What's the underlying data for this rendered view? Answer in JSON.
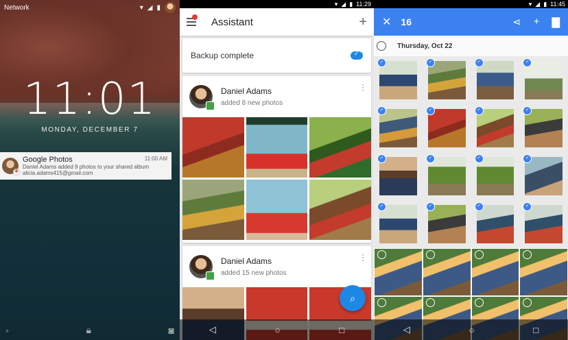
{
  "lock": {
    "network": "Network",
    "time": "11:01",
    "date": "MONDAY, DECEMBER 7",
    "notification": {
      "title": "Google Photos",
      "time": "11:00 AM",
      "line1": "Daniel Adams added 9 photos to your shared album",
      "line2": "alicia.adams415@gmail.com"
    }
  },
  "assistant": {
    "status_time": "11:29",
    "title": "Assistant",
    "backup": "Backup complete",
    "cards": [
      {
        "name": "Daniel Adams",
        "sub": "added 8 new photos"
      },
      {
        "name": "Daniel Adams",
        "sub": "added 15 new photos"
      }
    ]
  },
  "selection": {
    "status_time": "11:45",
    "count": "16",
    "date": "Thursday, Oct 22"
  },
  "icons": {
    "menu": "menu-icon",
    "add": "plus-icon",
    "search": "search-icon",
    "share": "share-icon",
    "delete": "trash-icon",
    "close": "close-icon",
    "cloud": "cloud-done-icon",
    "lock": "lock-icon",
    "camera": "camera-icon"
  },
  "colors": {
    "accent": "#3b82f0",
    "fab": "#1e88e5",
    "badge": "#e53935",
    "album_badge": "#43a047"
  }
}
